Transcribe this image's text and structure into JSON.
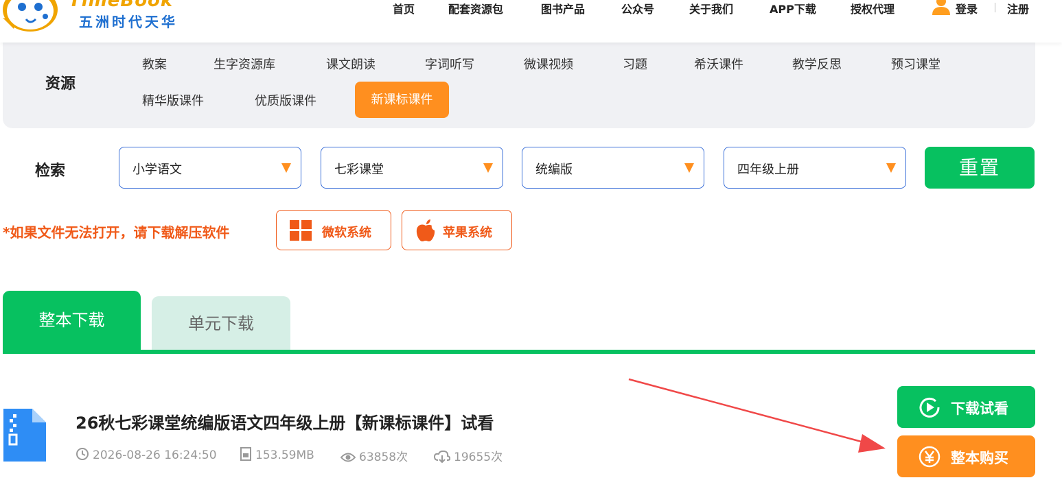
{
  "header": {
    "logo_en": "TimeBook",
    "logo_cn": "五洲时代天华",
    "nav": [
      "首页",
      "配套资源包",
      "图书产品",
      "公众号",
      "关于我们",
      "APP下载",
      "授权代理"
    ],
    "login": "登录",
    "register": "注册"
  },
  "resources": {
    "title": "资源",
    "items": [
      "教案",
      "生字资源库",
      "课文朗读",
      "字词听写",
      "微课视频",
      "习题",
      "希沃课件",
      "教学反思",
      "预习课堂",
      "精华版课件",
      "优质版课件",
      "新课标课件"
    ],
    "active": "新课标课件"
  },
  "search": {
    "label": "检索",
    "filters": [
      "小学语文",
      "七彩课堂",
      "统编版",
      "四年级上册"
    ],
    "reset": "重置"
  },
  "notice": {
    "text": "*如果文件无法打开，请下载解压软件",
    "windows": "微软系统",
    "apple": "苹果系统"
  },
  "tabs": {
    "whole": "整本下载",
    "unit": "单元下载",
    "active": "整本下载"
  },
  "file": {
    "title": "26秋七彩课堂统编版语文四年级上册【新课标课件】试看",
    "datetime": "2026-08-26 16:24:50",
    "size": "153.59MB",
    "views": "63858次",
    "downloads": "19655次",
    "trial_button": "下载试看",
    "buy_button": "整本购买"
  },
  "colors": {
    "green": "#07c160",
    "orange": "#ff8f1f",
    "notice_red": "#f05a19",
    "select_border": "#3a6fd8",
    "annotation_arrow": "#f04848"
  }
}
